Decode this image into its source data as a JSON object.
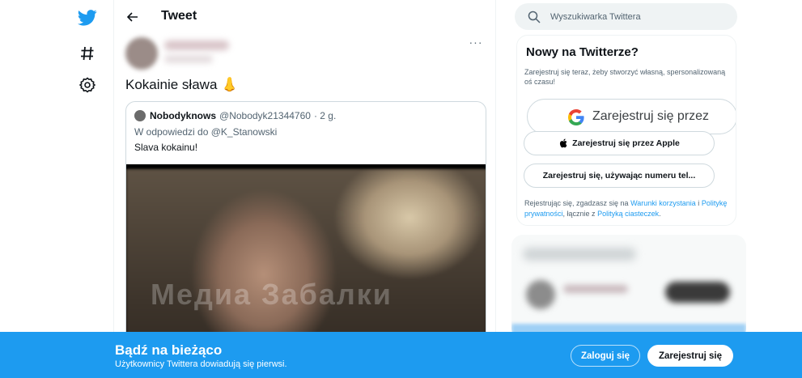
{
  "header": {
    "title": "Tweet"
  },
  "nav": {
    "icons": [
      "twitter-logo-icon",
      "hashtag-icon",
      "settings-gear-icon"
    ]
  },
  "tweet": {
    "text": "Kokainie sława 👃",
    "more_label": "···",
    "quote": {
      "name": "Nobodyknows",
      "handle": "@Nobodyk21344760",
      "time": "· 2 g.",
      "reply_prefix": "W odpowiedzi do",
      "reply_to": "@K_Stanowski",
      "text": "Slava kokainu!",
      "watermark": "Медиа Забалки"
    }
  },
  "search": {
    "placeholder": "Wyszukiwarka Twittera"
  },
  "signup_card": {
    "title": "Nowy na Twitterze?",
    "description": "Zarejestruj się teraz, żeby stworzyć własną, spersonalizowaną oś czasu!",
    "google_label": "Zarejestruj się przez",
    "apple_label": "Zarejestruj się przez Apple",
    "phone_label": "Zarejestruj się, używając numeru tel...",
    "terms_prefix": "Rejestrując się, zgadzasz się na",
    "terms_link": "Warunki korzystania",
    "terms_and": "i",
    "privacy_link": "Politykę prywatności",
    "terms_mid": ", łącznie z",
    "cookies_link": "Polityką ciasteczek",
    "terms_end": "."
  },
  "banner": {
    "title": "Bądź na bieżąco",
    "subtitle": "Użytkownicy Twittera dowiadują się pierwsi.",
    "login_label": "Zaloguj się",
    "signup_label": "Zarejestruj się"
  },
  "colors": {
    "brand": "#1d9bf0",
    "text": "#0f1419",
    "secondary": "#536471"
  }
}
